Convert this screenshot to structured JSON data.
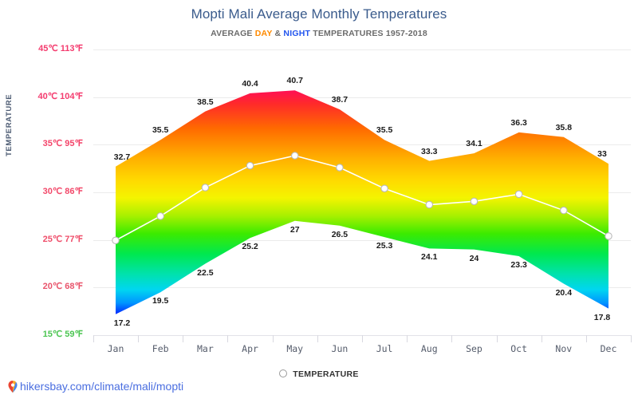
{
  "header": {
    "title": "Mopti Mali Average Monthly Temperatures",
    "subtitle_pre": "AVERAGE ",
    "subtitle_day": "DAY",
    "subtitle_mid": " & ",
    "subtitle_night": "NIGHT",
    "subtitle_post": " TEMPERATURES 1957-2018"
  },
  "axis": {
    "y_title": "TEMPERATURE"
  },
  "legend": {
    "label": "TEMPERATURE",
    "marker": "circle-marker-icon"
  },
  "footer": {
    "icon": "location-pin-icon",
    "url": "hikersbay.com/climate/mali/mopti"
  },
  "colors": {
    "title": "#3a5b8c",
    "day_accent": "#ff8a00",
    "night_accent": "#2255ee",
    "link": "#4a6ee0",
    "grid": "#ebebeb",
    "axis_label": "#555c6b",
    "gradient_stops": [
      "#ff1f5a",
      "#ff2a17",
      "#ff8c00",
      "#ffd400",
      "#f2f500",
      "#55e800",
      "#00e55a",
      "#00e8c8",
      "#00a8ff",
      "#0040ff"
    ]
  },
  "chart_data": {
    "type": "area",
    "title": "Mopti Mali Average Monthly Temperatures",
    "subtitle": "AVERAGE DAY & NIGHT TEMPERATURES 1957-2018",
    "xlabel": "",
    "ylabel": "TEMPERATURE",
    "grid": true,
    "legend_position": "bottom",
    "categories": [
      "Jan",
      "Feb",
      "Mar",
      "Apr",
      "May",
      "Jun",
      "Jul",
      "Aug",
      "Sep",
      "Oct",
      "Nov",
      "Dec"
    ],
    "ylim": [
      15,
      45
    ],
    "yticks": [
      {
        "c": 45,
        "f": 113,
        "label": "45℃ 113℉",
        "color": "#f43b6e"
      },
      {
        "c": 40,
        "f": 104,
        "label": "40℃ 104℉",
        "color": "#f43b6e"
      },
      {
        "c": 35,
        "f": 95,
        "label": "35℃ 95℉",
        "color": "#f4446a"
      },
      {
        "c": 30,
        "f": 86,
        "label": "30℃ 86℉",
        "color": "#f2496a"
      },
      {
        "c": 25,
        "f": 77,
        "label": "25℃ 77℉",
        "color": "#ef4f6b"
      },
      {
        "c": 20,
        "f": 68,
        "label": "20℃ 68℉",
        "color": "#e9556c"
      },
      {
        "c": 15,
        "f": 59,
        "label": "15℃ 59℉",
        "color": "#4cc552"
      }
    ],
    "series": [
      {
        "name": "DAY",
        "values": [
          32.7,
          35.5,
          38.5,
          40.4,
          40.7,
          38.7,
          35.5,
          33.3,
          34.1,
          36.3,
          35.8,
          33
        ]
      },
      {
        "name": "NIGHT",
        "values": [
          17.2,
          19.5,
          22.5,
          25.2,
          27,
          26.5,
          25.3,
          24.1,
          24,
          23.3,
          20.4,
          17.8
        ]
      },
      {
        "name": "TEMPERATURE",
        "values": [
          24.95,
          27.5,
          30.5,
          32.8,
          33.85,
          32.6,
          30.4,
          28.7,
          29.05,
          29.8,
          28.1,
          25.4
        ]
      }
    ]
  }
}
